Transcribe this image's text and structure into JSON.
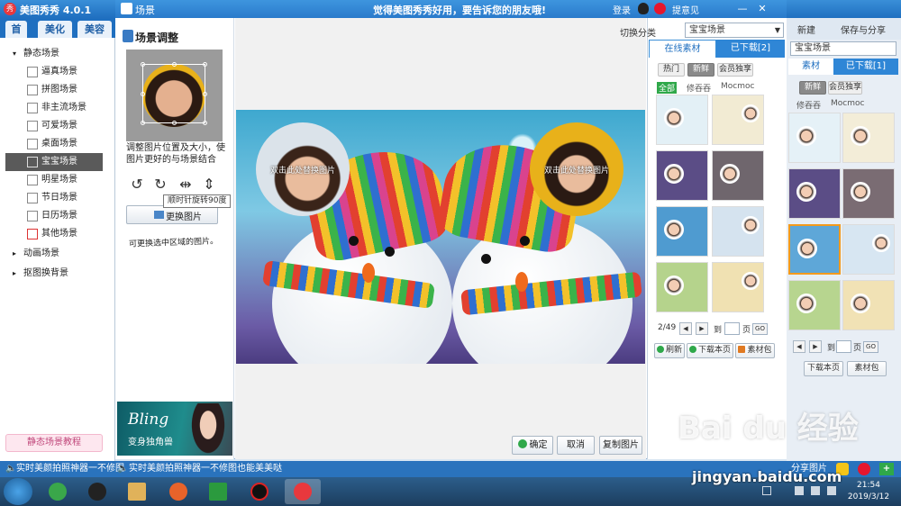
{
  "main_window": {
    "app_title": "美图秀秀 4.0.1",
    "tabs": [
      "首",
      "美化",
      "美容"
    ],
    "tree": {
      "static_root": "静态场景",
      "static_items": [
        "逼真场景",
        "拼图场景",
        "非主流场景",
        "可爱场景",
        "桌面场景",
        "宝宝场景",
        "明星场景",
        "节日场景",
        "日历场景",
        "其他场景"
      ],
      "selected_index": 5,
      "animated_root": "动画场景",
      "cutout_root": "抠图换背景"
    },
    "tutorial_button": "静态场景教程"
  },
  "dialog": {
    "title": "场景",
    "slogan": "觉得美图秀秀好用，要告诉您的朋友哦!",
    "login": "登录",
    "feedback": "提意见",
    "adjust": {
      "title": "场景调整",
      "hint": "调整图片位置及大小，使图片更好的与场景结合",
      "tooltip": "顺时针旋转90度",
      "change_button": "更换图片",
      "handwritten_note": "可更换选中区域的图片。"
    },
    "banner": {
      "title": "Bling",
      "subtitle": "变身独角兽"
    },
    "preview": {
      "slot_label_1": "双击此处替换图片",
      "slot_label_2": "双击此处替换图片"
    },
    "buttons": {
      "ok": "确定",
      "cancel": "取消",
      "copy": "复制图片"
    },
    "materials": {
      "switch_label": "切换分类",
      "category_value": "宝宝场景",
      "tab_online": "在线素材",
      "tab_downloaded": "已下载[2]",
      "filters": [
        "热门",
        "新鲜",
        "会员独享"
      ],
      "filter_selected": "新鲜",
      "sub_filters": [
        "全部",
        "修吞吞",
        "Mocmoc"
      ],
      "sub_selected": "全部",
      "page_indicator": "2/49",
      "page_to": "到",
      "page_unit": "页",
      "go": "GO",
      "refresh": "刷新",
      "download_page": "下载本页",
      "material_pack": "素材包"
    }
  },
  "bg_panel": {
    "new_label": "新建",
    "save_share_label": "保存与分享",
    "category_value": "宝宝场景",
    "tab_online": "素材",
    "tab_downloaded": "已下载[1]",
    "filters": [
      "新鲜",
      "会员独享"
    ],
    "sub_filters": [
      "修吞吞",
      "Mocmoc"
    ],
    "download_page": "下载本页",
    "material_pack": "素材包",
    "page_to": "到",
    "page_unit": "页",
    "go": "GO",
    "share_label": "分享图片"
  },
  "status_bar": {
    "text_1": "实时美颜拍照神器一不修图",
    "text_2": "实时美颜拍照神器一不修图也能美美哒"
  },
  "taskbar": {
    "time": "21:54",
    "date": "2019/3/12"
  },
  "watermark": {
    "text": "Bai du 经验",
    "url": "jingyan.baidu.com"
  },
  "colors": {
    "title_blue": "#2a7acb",
    "accent_green": "#2fa84a",
    "selected_gray": "#5a5a5a"
  }
}
